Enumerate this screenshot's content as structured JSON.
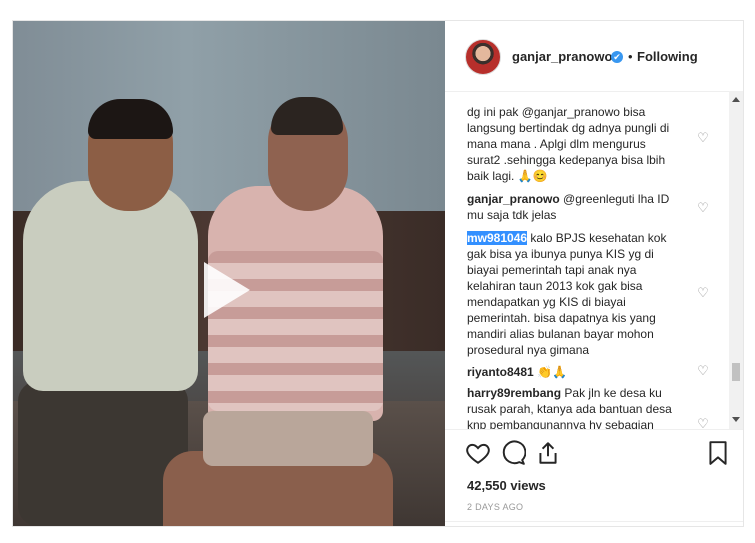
{
  "header": {
    "username": "ganjar_pranowo",
    "verified_icon": "✔",
    "separator": "•",
    "follow_status": "Following"
  },
  "comments": [
    {
      "user": "",
      "text": "dg ini pak @ganjar_pranowo bisa langsung bertindak dg adnya pungli di mana mana . Aplgi dlm mengurus surat2 .sehingga kedepanya bisa lbih baik lagi. 🙏😊"
    },
    {
      "user": "ganjar_pranowo",
      "text": "@greenleguti lha ID mu saja tdk jelas"
    },
    {
      "user": "mw981046",
      "text": "kalo BPJS kesehatan kok gak bisa ya ibunya punya KIS yg di biayai pemerintah tapi anak nya kelahiran taun 2013 kok gak bisa mendapatkan yg KIS di biayai pemerintah. bisa dapatnya kis yang mandiri alias bulanan bayar mohon prosedural nya gimana"
    },
    {
      "user": "riyanto8481",
      "text": "👏🙏"
    },
    {
      "user": "harry89rembang",
      "text": "Pak jln ke desa ku rusak parah, ktanya ada bantuan desa knp pembangunannya hy sebagian aja..?? Tlg keterangan nya"
    }
  ],
  "stats": {
    "views": "42,550 views",
    "posted": "2 DAYS AGO"
  },
  "icons": {
    "like": "heart-icon",
    "comment": "comment-icon",
    "share": "share-icon",
    "save": "bookmark-icon",
    "play": "play-icon"
  },
  "colors": {
    "verified": "#3897f0",
    "highlight": "#3390ff",
    "text": "#262626",
    "muted": "#999999"
  }
}
